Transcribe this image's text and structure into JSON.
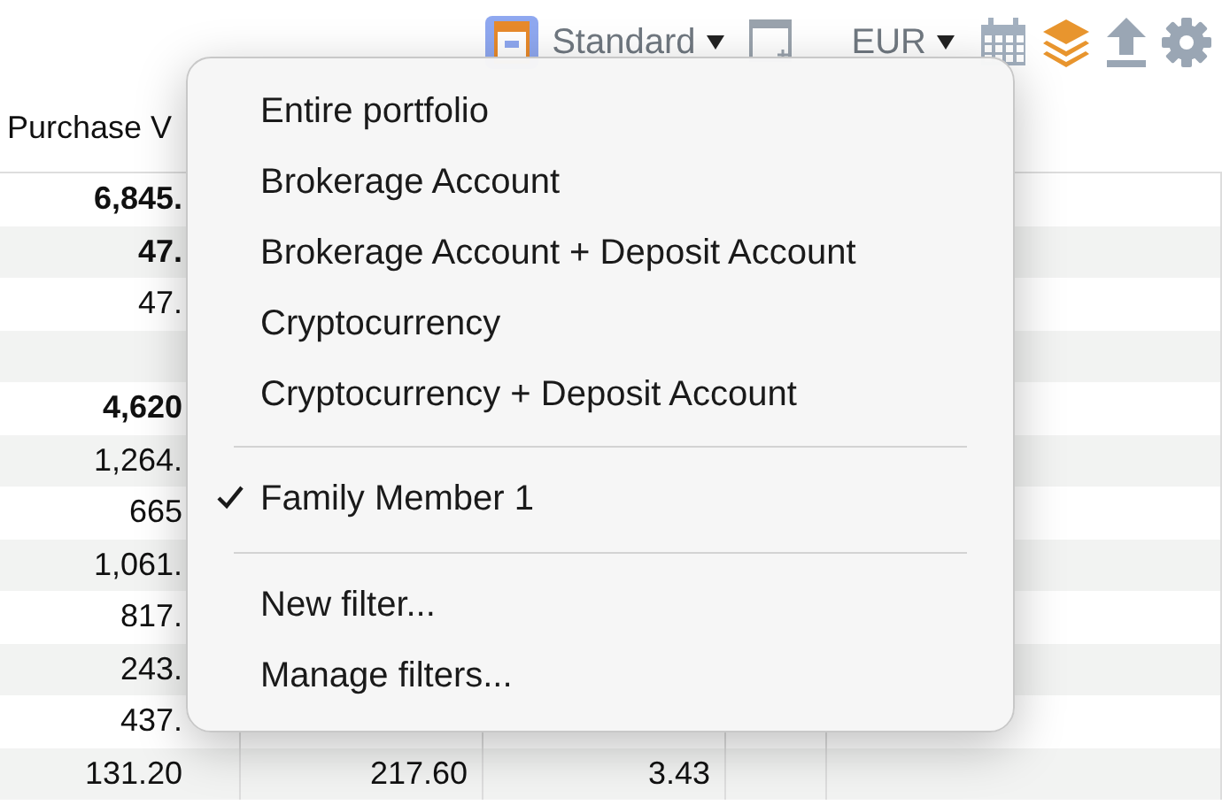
{
  "toolbar": {
    "view_label": "Standard",
    "currency": "EUR"
  },
  "table": {
    "columns": [
      "Purchase V"
    ],
    "rows": [
      {
        "cells": [
          "6,845."
        ],
        "bold": true
      },
      {
        "cells": [
          "47."
        ],
        "bold": true
      },
      {
        "cells": [
          "47."
        ],
        "bold": false
      },
      {
        "cells": []
      },
      {
        "cells": [
          "4,620"
        ],
        "bold": true
      },
      {
        "cells": [
          "1,264."
        ],
        "bold": false
      },
      {
        "cells": [
          "665"
        ],
        "bold": false
      },
      {
        "cells": [
          "1,061."
        ],
        "bold": false
      },
      {
        "cells": [
          "817."
        ],
        "bold": false
      },
      {
        "cells": [
          "243."
        ],
        "bold": false
      },
      {
        "cells": [
          "437."
        ],
        "bold": false
      },
      {
        "cells": [
          "131.20",
          "217.60",
          "3.43"
        ],
        "bold": false
      }
    ]
  },
  "menu": {
    "items": [
      {
        "kind": "item",
        "label": "Entire portfolio",
        "selected": false
      },
      {
        "kind": "item",
        "label": "Brokerage Account",
        "selected": false
      },
      {
        "kind": "item",
        "label": "Brokerage Account + Deposit Account",
        "selected": false
      },
      {
        "kind": "item",
        "label": "Cryptocurrency",
        "selected": false
      },
      {
        "kind": "item",
        "label": "Cryptocurrency + Deposit Account",
        "selected": false
      },
      {
        "kind": "separator"
      },
      {
        "kind": "item",
        "label": "Family Member 1",
        "selected": true
      },
      {
        "kind": "separator"
      },
      {
        "kind": "item",
        "label": "New filter...",
        "selected": false
      },
      {
        "kind": "item",
        "label": "Manage filters...",
        "selected": false
      }
    ]
  }
}
